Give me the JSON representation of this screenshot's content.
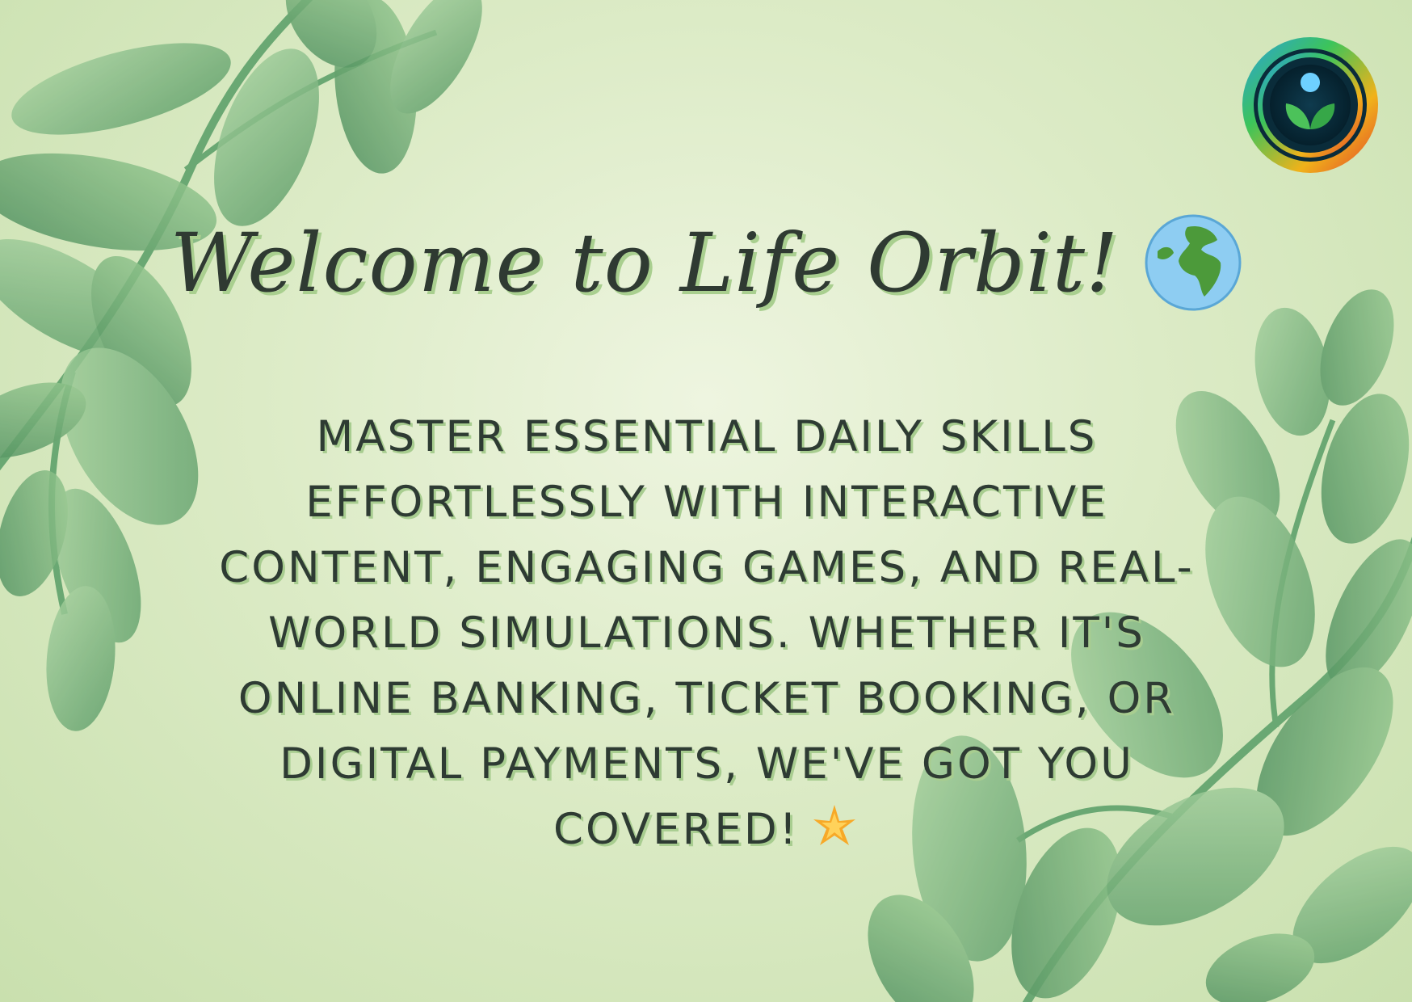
{
  "card": {
    "title": "Welcome to Life Orbit!",
    "title_emoji_icon": "globe-icon",
    "body": "MASTER ESSENTIAL DAILY SKILLS EFFORTLESSLY WITH INTERACTIVE CONTENT, ENGAGING GAMES, AND REAL-WORLD SIMULATIONS. WHETHER IT'S ONLINE BANKING, TICKET BOOKING, OR DIGITAL PAYMENTS, WE'VE GOT YOU COVERED!",
    "body_emoji_icon": "sparkle-star-icon",
    "logo_icon": "life-orbit-logo-icon"
  },
  "colors": {
    "background": "#dcebc6",
    "text": "#2e3b33",
    "text_shadow": "#a8cd90",
    "leaf": "#7fb87e",
    "leaf_dark": "#5f9e68"
  }
}
